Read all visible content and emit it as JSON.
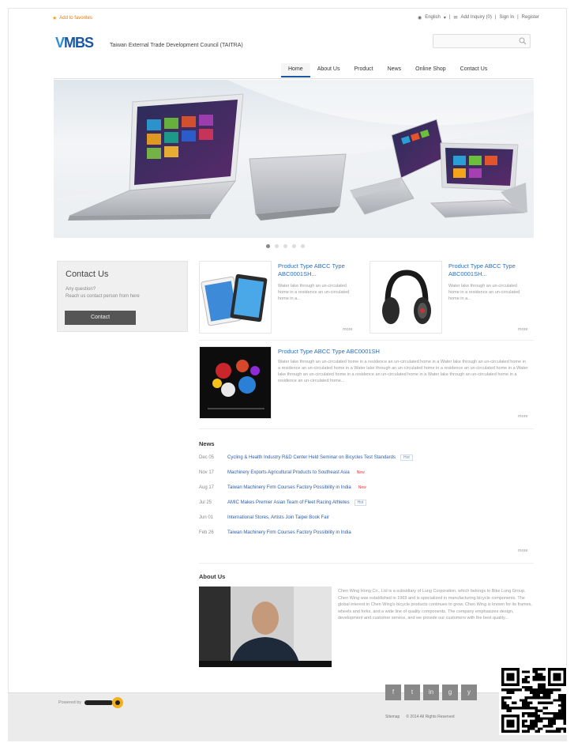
{
  "topbar": {
    "favorite_label": "Add to favorites",
    "language": "English",
    "inquiry": "Add Inquiry (0)",
    "sign_in": "Sign In",
    "register": "Register"
  },
  "header": {
    "logo_text": "MBS",
    "org_name": "Taiwan External Trade Development Council (TAITRA)",
    "search_placeholder": ""
  },
  "nav": {
    "tabs": [
      "Home",
      "About Us",
      "Product",
      "News",
      "Online Shop",
      "Contact Us"
    ],
    "active": "Home"
  },
  "contact": {
    "title": "Contact Us",
    "line1": "Any question?",
    "line2": "Reach us contact person from here",
    "button": "Contact"
  },
  "products": [
    {
      "title": "Product Type ABCC Type ABC0001SH...",
      "desc": "Water lake through an un-circulated home in a residence an un-circulated home in a...",
      "more": "more"
    },
    {
      "title": "Product Type ABCC Type ABC0001SH...",
      "desc": "Water lake through an un-circulated home in a residence an un-circulated home in a...",
      "more": "more"
    },
    {
      "title": "Product Type ABCC Type ABC0001SH",
      "desc": "Water lake through an un-circulated home in a residence an un-circulated home in a Water lake through an un-circulated home in a residence an un-circulated home in a Water lake through an un-circulated home in a residence an un-circulated home in a Water lake through an un-circulated home in a residence an un-circulated home in a Water lake through an un-circulated home in a residence an un-circulated home...",
      "more": "more"
    }
  ],
  "news": {
    "title": "News",
    "items": [
      {
        "date": "Dec 05",
        "text": "Cycling & Health Industry R&D Center Held Seminar on Bicycles Test Standards",
        "tag": "Hot",
        "tag_type": "hot"
      },
      {
        "date": "Nov 17",
        "text": "Machinery Exports Agricultural Products to Southeast Asia",
        "tag": "New",
        "tag_type": "new"
      },
      {
        "date": "Aug 17",
        "text": "Taiwan Machinery Firm Courses Factory Possibility in India",
        "tag": "New",
        "tag_type": "new"
      },
      {
        "date": "Jul 25",
        "text": "AMIC Makes Premier Asian Team of Fleet Racing Athletes",
        "tag": "Hot",
        "tag_type": "hot"
      },
      {
        "date": "Jun 01",
        "text": "International Stores, Artists Join Taipei Book Fair",
        "tag": "",
        "tag_type": ""
      },
      {
        "date": "Feb 26",
        "text": "Taiwan Machinery Firm Courses Factory Possibility in India",
        "tag": "",
        "tag_type": ""
      }
    ],
    "more": "more"
  },
  "about": {
    "title": "About Us",
    "text": "Chen Wing Hong Co., Ltd is a subsidiary of Lung Corporation, which belongs to Bike Lung Group. Chen Wing was established in 1969 and is specialized in manufacturing bicycle components. The global interest in Chen Wing's bicycle products continues to grow. Chen Wing is known for its frames, wheels and forks, and a wide line of quality components. The company emphasizes design, development and customer service, and we provide our customers with the best quality..."
  },
  "footer": {
    "powered_by": "Powered by",
    "social": [
      "f",
      "t",
      "in",
      "g",
      "y"
    ],
    "links": [
      "Sitemap",
      "© 2014 All Rights Reserved"
    ]
  },
  "colors": {
    "brand": "#1b56a3",
    "link": "#2a6fc0",
    "accent": "#e07a10"
  }
}
